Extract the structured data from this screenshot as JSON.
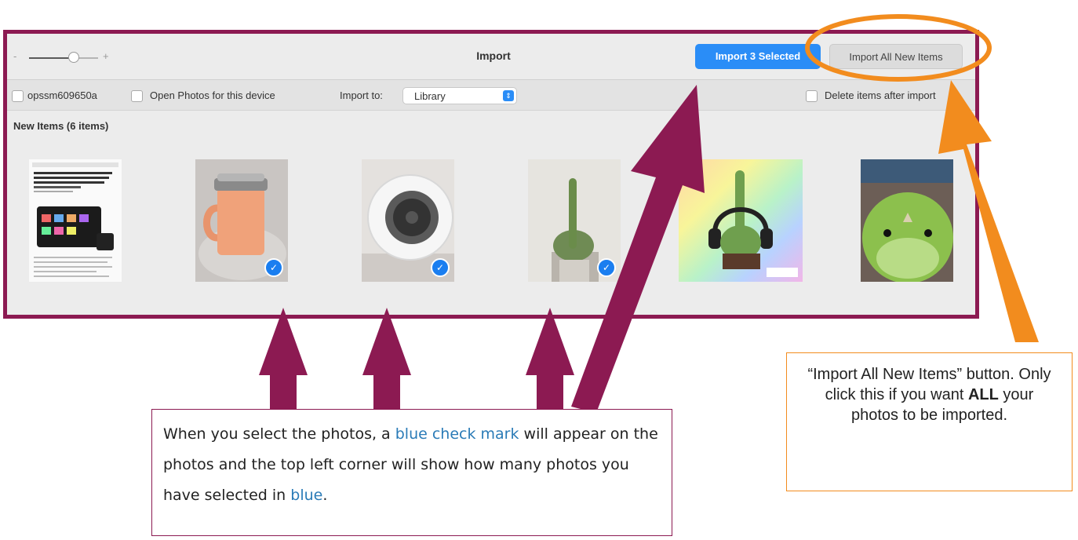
{
  "window": {
    "title": "Import",
    "zoom_minus": "-",
    "zoom_plus": "+",
    "import_selected_label": "Import 3 Selected",
    "import_all_label": "Import All New Items"
  },
  "toolbar": {
    "device_name": "opssm609650a",
    "open_photos_label": "Open Photos for this device",
    "import_to_label": "Import to:",
    "import_to_value": "Library",
    "delete_after_label": "Delete items after import"
  },
  "section": {
    "title": "New Items (6 items)"
  },
  "thumbnails": [
    {
      "name": "screenshot-thumbnail",
      "selected": false
    },
    {
      "name": "orange-mug-thumbnail",
      "selected": true
    },
    {
      "name": "white-device-thumbnail",
      "selected": true
    },
    {
      "name": "cactus-thumbnail",
      "selected": true
    },
    {
      "name": "rainbow-cactus-thumbnail",
      "selected": false
    },
    {
      "name": "green-plush-thumbnail",
      "selected": false
    }
  ],
  "callout_left": {
    "part1": "When you select the photos, a ",
    "blue1": "blue check mark",
    "part2": " will appear on the photos and the top left corner will show how many photos you have selected in ",
    "blue2": "blue",
    "part3": "."
  },
  "callout_right": {
    "part1": "“Import All New Items” button. Only click this if you want ",
    "bold": "ALL",
    "part2": " your photos to be imported."
  },
  "colors": {
    "annotation_maroon": "#8c1a52",
    "annotation_orange": "#f28c1e",
    "accent_blue": "#2a8df7"
  }
}
